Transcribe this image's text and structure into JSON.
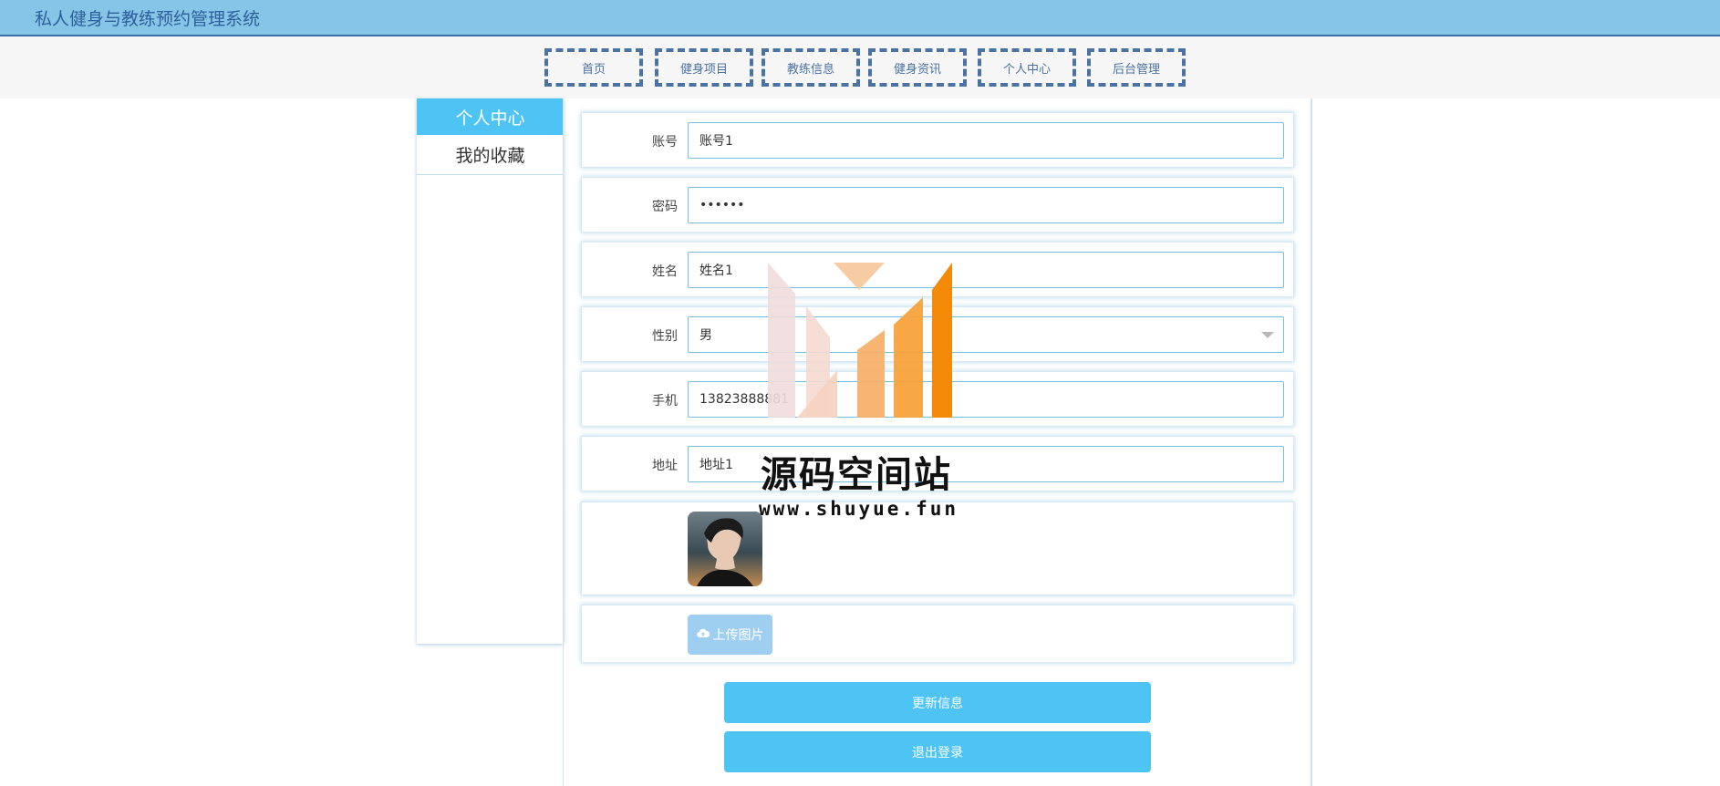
{
  "app": {
    "title": "私人健身与教练预约管理系统"
  },
  "nav": {
    "items": [
      "首页",
      "健身项目",
      "教练信息",
      "健身资讯",
      "个人中心",
      "后台管理"
    ]
  },
  "sidebar": {
    "active": "个人中心",
    "items": [
      "我的收藏"
    ]
  },
  "form": {
    "account_label": "账号",
    "account_value": "账号1",
    "password_label": "密码",
    "password_value": "••••••",
    "name_label": "姓名",
    "name_value": "姓名1",
    "gender_label": "性别",
    "gender_value": "男",
    "phone_label": "手机",
    "phone_value": "13823888881",
    "address_label": "地址",
    "address_value": "地址1",
    "upload_label": "上传图片",
    "upload_icon": "cloud-upload-icon"
  },
  "actions": {
    "update_label": "更新信息",
    "logout_label": "退出登录"
  },
  "watermark": {
    "title": "源码空间站",
    "url": "www.shuyue.fun"
  },
  "colors": {
    "topbar": "#86c5e6",
    "accent": "#4ec4f4",
    "nav_border": "#4a72a3"
  }
}
